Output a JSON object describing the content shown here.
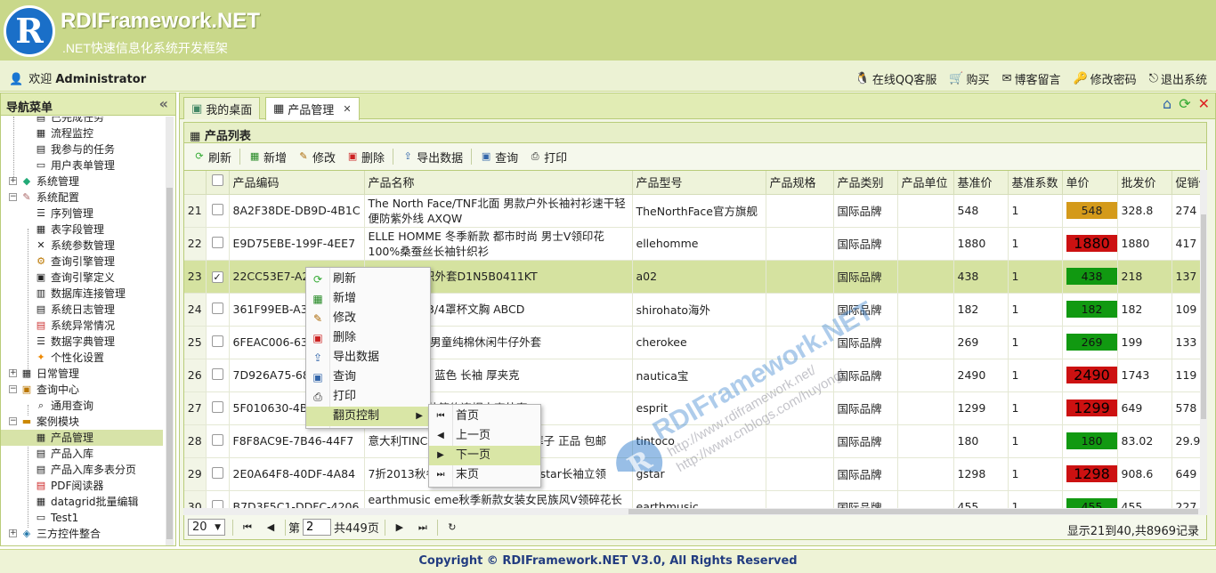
{
  "header": {
    "logo_letter": "R",
    "title": "RDIFramework.NET",
    "subtitle": ".NET快速信息化系统开发框架"
  },
  "topbar": {
    "welcome_prefix": "欢迎",
    "user": "Administrator",
    "links": [
      "在线QQ客服",
      "购买",
      "博客留言",
      "修改密码",
      "退出系统"
    ]
  },
  "sidebar": {
    "title": "导航菜单",
    "nodes": [
      "已完成任务",
      "流程监控",
      "我参与的任务",
      "用户表单管理",
      "系统管理",
      "系统配置",
      "序列管理",
      "表字段管理",
      "系统参数管理",
      "查询引擎管理",
      "查询引擎定义",
      "数据库连接管理",
      "系统日志管理",
      "系统异常情况",
      "数据字典管理",
      "个性化设置",
      "日常管理",
      "查询中心",
      "通用查询",
      "案例模块",
      "产品管理",
      "产品入库",
      "产品入库多表分页",
      "PDF阅读器",
      "datagrid批量编辑",
      "Test1",
      "三方控件整合"
    ]
  },
  "tabs": [
    {
      "label": "我的桌面"
    },
    {
      "label": "产品管理"
    }
  ],
  "panel": {
    "title": "产品列表"
  },
  "toolbar": {
    "buttons": [
      "刷新",
      "新增",
      "修改",
      "删除",
      "导出数据",
      "查询",
      "打印"
    ]
  },
  "grid": {
    "columns": [
      "产品编码",
      "产品名称",
      "产品型号",
      "产品规格",
      "产品类别",
      "产品单位",
      "基准价",
      "基准系数",
      "单价",
      "批发价",
      "促销价"
    ],
    "rows": [
      {
        "n": "21",
        "code": "8A2F38DE-DB9D-4B1C",
        "name": "The North Face/TNF北面 男款户外长袖衬衫速干轻便防紫外线 AXQW",
        "model": "TheNorthFace官方旗舰",
        "spec": "",
        "cat": "国际品牌",
        "unit": "",
        "base": "548",
        "coef": "1",
        "price": "548",
        "whole": "328.8",
        "promo": "274",
        "checked": false
      },
      {
        "n": "22",
        "code": "E9D75EBE-199F-4EE7",
        "name": "ELLE HOMME 冬季新款 都市时尚 男士V领印花100%桑蚕丝长袖针织衫",
        "model": "ellehomme",
        "spec": "",
        "cat": "国际品牌",
        "unit": "",
        "base": "1880",
        "coef": "1",
        "price": "1880",
        "whole": "1880",
        "promo": "417",
        "checked": false
      },
      {
        "n": "23",
        "code": "22CC53E7-A2",
        "name": "时尚修身针织外套D1N5B0411KT",
        "model": "a02",
        "spec": "",
        "cat": "国际品牌",
        "unit": "",
        "base": "438",
        "coef": "1",
        "price": "438",
        "whole": "218",
        "promo": "137",
        "checked": true
      },
      {
        "n": "24",
        "code": "361F99EB-A3",
        "name": "可爱蕾絲邊 3/4罩杯文胸 ABCD",
        "model": "shirohato海外",
        "spec": "",
        "cat": "国际品牌",
        "unit": "",
        "base": "182",
        "coef": "1",
        "price": "182",
        "whole": "182",
        "promo": "109",
        "checked": false
      },
      {
        "n": "25",
        "code": "6FEAC006-63",
        "name": "品cherokee男童纯棉休闲牛仔外套",
        "model": "cherokee",
        "spec": "",
        "cat": "国际品牌",
        "unit": "",
        "base": "269",
        "coef": "1",
        "price": "269",
        "whole": "199",
        "promo": "133",
        "checked": false
      },
      {
        "n": "26",
        "code": "7D926A75-68",
        "name": "/诺帝卡 男士 蓝色 长袖 厚夹克",
        "model": "nautica宝",
        "spec": "",
        "cat": "国际品牌",
        "unit": "",
        "base": "2490",
        "coef": "1",
        "price": "2490",
        "whole": "1743",
        "promo": "119",
        "checked": false
      },
      {
        "n": "27",
        "code": "5F010630-4B",
        "name": "斯普利特 男装简约连帽夹克外套",
        "model": "esprit",
        "spec": "",
        "cat": "国际品牌",
        "unit": "",
        "base": "1299",
        "coef": "1",
        "price": "1299",
        "whole": "649",
        "promo": "578",
        "checked": false
      },
      {
        "n": "28",
        "code": "F8F8AC9E-7B46-44F7",
        "name": "意大利TINCO 冬季新款 夜间美腿裤子 正品 包邮",
        "model": "tintoco",
        "spec": "",
        "cat": "国际品牌",
        "unit": "",
        "base": "180",
        "coef": "1",
        "price": "180",
        "whole": "83.02",
        "promo": "29.9",
        "checked": false
      },
      {
        "n": "29",
        "code": "2E0A64F8-40DF-4A84",
        "name": "7折2013秋冬 男装秋冬休闲时尚 gstar长袖立领",
        "model": "gstar",
        "spec": "",
        "cat": "国际品牌",
        "unit": "",
        "base": "1298",
        "coef": "1",
        "price": "1298",
        "whole": "908.6",
        "promo": "649",
        "checked": false
      },
      {
        "n": "30",
        "code": "B7D3F5C1-DDFC-4206",
        "name": "earthmusic eme秋季新款女装女民族风V领碎花长袖衬衣18123G12030",
        "model": "earthmusic",
        "spec": "",
        "cat": "国际品牌",
        "unit": "",
        "base": "455",
        "coef": "1",
        "price": "455",
        "whole": "455",
        "promo": "227",
        "checked": false
      }
    ]
  },
  "pager": {
    "page_size": "20",
    "page_prefix": "第",
    "page": "2",
    "page_total": "共449页",
    "info": "显示21到40,共8969记录"
  },
  "context_menu": {
    "items": [
      "刷新",
      "新增",
      "修改",
      "删除",
      "导出数据",
      "查询",
      "打印",
      "翻页控制"
    ],
    "submenu": [
      "首页",
      "上一页",
      "下一页",
      "末页"
    ]
  },
  "watermark": {
    "brand": "RDIFramework.NET",
    "url1": "http://www.rdiframework.net/",
    "url2": "http://www.cnblogs.com/huyong/"
  },
  "footer": {
    "text": "Copyright © RDIFramework.NET V3.0, All Rights Reserved"
  },
  "colors": {
    "header_bg": "#c9d88a",
    "accent_blue": "#1a6fc8",
    "price_orange": "#d49a1a",
    "price_red": "#cc1111",
    "price_green": "#119911",
    "selected_row": "#d5e2a0"
  }
}
